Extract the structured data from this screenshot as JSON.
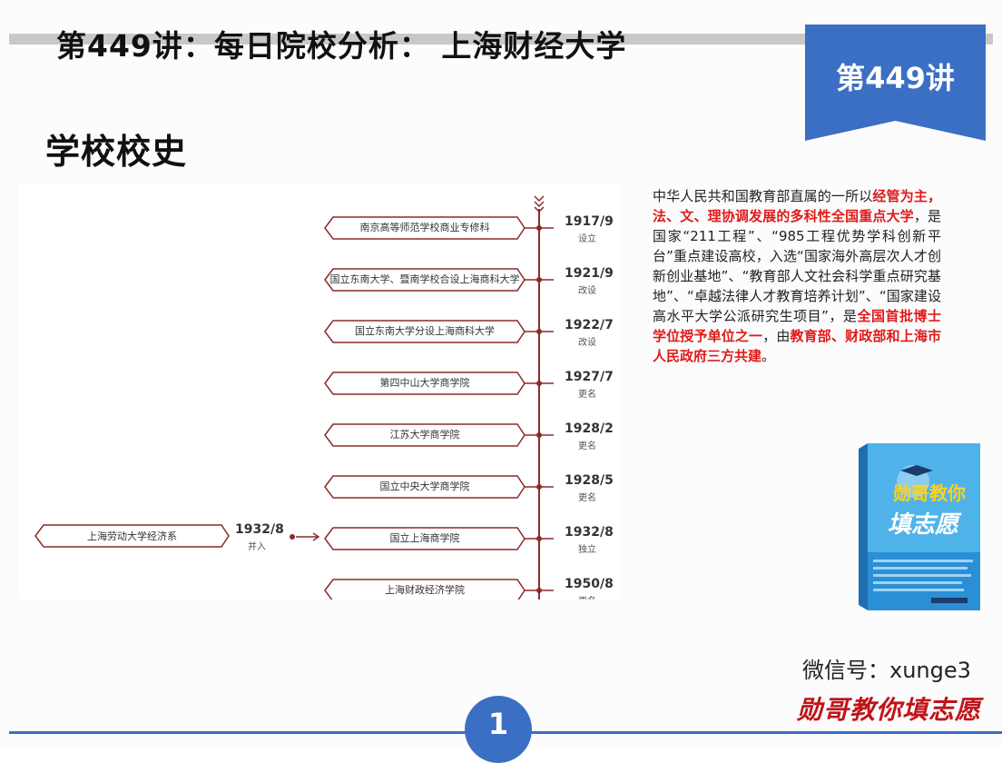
{
  "header": {
    "title": "第449讲：每日院校分析：  上海财经大学",
    "badge": "第449讲"
  },
  "section_title": "学校校史",
  "timeline": {
    "stages": [
      {
        "name": "南京高等师范学校商业专修科",
        "year": "1917/9",
        "status": "设立"
      },
      {
        "name": "国立东南大学、暨南学校合设上海商科大学",
        "year": "1921/9",
        "status": "改设"
      },
      {
        "name": "国立东南大学分设上海商科大学",
        "year": "1922/7",
        "status": "改设"
      },
      {
        "name": "第四中山大学商学院",
        "year": "1927/7",
        "status": "更名"
      },
      {
        "name": "江苏大学商学院",
        "year": "1928/2",
        "status": "更名"
      },
      {
        "name": "国立中央大学商学院",
        "year": "1928/5",
        "status": "更名"
      },
      {
        "name": "国立上海商学院",
        "year": "1932/8",
        "status": "独立"
      },
      {
        "name": "上海财政经济学院",
        "year": "1950/8",
        "status": "更名"
      }
    ],
    "merge": {
      "name": "上海劳动大学经济系",
      "year": "1932/8",
      "status": "并入"
    }
  },
  "description": {
    "segments": [
      {
        "text": "中华人民共和国教育部直属的一所以",
        "highlight": false
      },
      {
        "text": "经管为主，法、文、理协调发展的多科性全国重点大学",
        "highlight": true
      },
      {
        "text": "，是国家“211工程”、“985工程优势学科创新平台”重点建设高校，入选“国家海外高层次人才创新创业基地”、“教育部人文社会科学重点研究基地”、“卓越法律人才教育培养计划”、“国家建设高水平大学公派研究生项目”，是",
        "highlight": false
      },
      {
        "text": "全国首批博士学位授予单位之一",
        "highlight": true
      },
      {
        "text": "，由",
        "highlight": false
      },
      {
        "text": "教育部、财政部和上海市人民政府三方共建",
        "highlight": true
      },
      {
        "text": "。",
        "highlight": false
      }
    ]
  },
  "book": {
    "title": "勋哥教你填志愿"
  },
  "footer": {
    "wechat": "微信号：xunge3",
    "brand": "勋哥教你填志愿",
    "page_number": "1"
  },
  "colors": {
    "accent_blue": "#3a6fc4",
    "timeline_red": "#8b2a2a",
    "highlight_red": "#e01a1a"
  }
}
